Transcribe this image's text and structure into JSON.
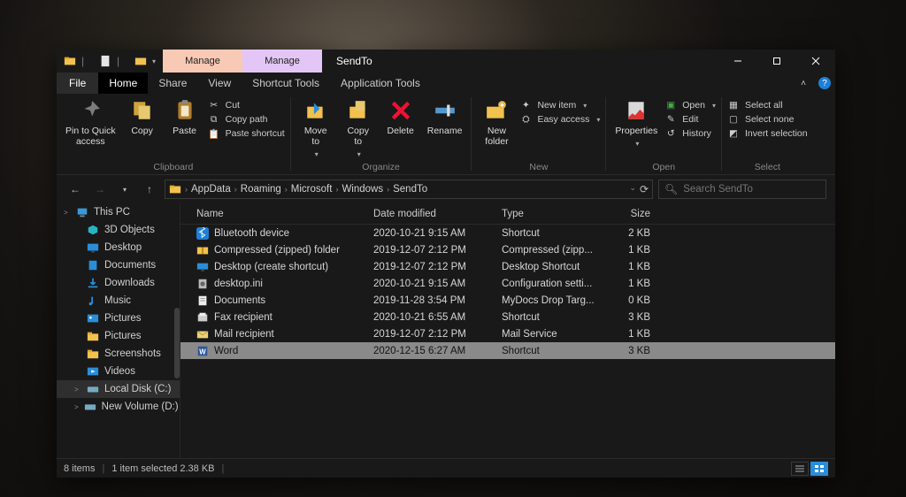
{
  "window": {
    "title": "SendTo",
    "context_tabs": [
      "Manage",
      "Manage"
    ],
    "sysbuttons": {
      "min": "minimize",
      "max": "maximize",
      "close": "close"
    }
  },
  "tabs": {
    "file": "File",
    "items": [
      "Home",
      "Share",
      "View",
      "Shortcut Tools",
      "Application Tools"
    ],
    "active": "Home"
  },
  "ribbon": {
    "clipboard": {
      "label": "Clipboard",
      "pin": "Pin to Quick\naccess",
      "copy": "Copy",
      "paste": "Paste",
      "cut": "Cut",
      "copy_path": "Copy path",
      "paste_shortcut": "Paste shortcut"
    },
    "organize": {
      "label": "Organize",
      "move_to": "Move\nto",
      "copy_to": "Copy\nto",
      "delete": "Delete",
      "rename": "Rename"
    },
    "new": {
      "label": "New",
      "new_folder": "New\nfolder",
      "new_item": "New item",
      "easy_access": "Easy access"
    },
    "open": {
      "label": "Open",
      "properties": "Properties",
      "open": "Open",
      "edit": "Edit",
      "history": "History"
    },
    "select": {
      "label": "Select",
      "select_all": "Select all",
      "select_none": "Select none",
      "invert": "Invert selection"
    }
  },
  "breadcrumb": [
    "AppData",
    "Roaming",
    "Microsoft",
    "Windows",
    "SendTo"
  ],
  "search": {
    "placeholder": "Search SendTo"
  },
  "nav": {
    "items": [
      {
        "label": "This PC",
        "icon": "pc",
        "indent": 0,
        "expand": ">"
      },
      {
        "label": "3D Objects",
        "icon": "3d",
        "indent": 1
      },
      {
        "label": "Desktop",
        "icon": "desktop",
        "indent": 1
      },
      {
        "label": "Documents",
        "icon": "documents",
        "indent": 1
      },
      {
        "label": "Downloads",
        "icon": "downloads",
        "indent": 1
      },
      {
        "label": "Music",
        "icon": "music",
        "indent": 1
      },
      {
        "label": "Pictures",
        "icon": "pictures-lib",
        "indent": 1
      },
      {
        "label": "Pictures",
        "icon": "folder",
        "indent": 1
      },
      {
        "label": "Screenshots",
        "icon": "folder",
        "indent": 1
      },
      {
        "label": "Videos",
        "icon": "videos",
        "indent": 1
      },
      {
        "label": "Local Disk (C:)",
        "icon": "disk",
        "indent": 1,
        "selected": true,
        "expand": ">"
      },
      {
        "label": "New Volume (D:)",
        "icon": "disk",
        "indent": 1,
        "expand": ">"
      }
    ]
  },
  "columns": {
    "name": "Name",
    "date": "Date modified",
    "type": "Type",
    "size": "Size"
  },
  "files": [
    {
      "name": "Bluetooth device",
      "icon": "bt",
      "date": "2020-10-21 9:15 AM",
      "type": "Shortcut",
      "size": "2 KB"
    },
    {
      "name": "Compressed (zipped) folder",
      "icon": "zip",
      "date": "2019-12-07 2:12 PM",
      "type": "Compressed (zipp...",
      "size": "1 KB"
    },
    {
      "name": "Desktop (create shortcut)",
      "icon": "desktop",
      "date": "2019-12-07 2:12 PM",
      "type": "Desktop Shortcut",
      "size": "1 KB"
    },
    {
      "name": "desktop.ini",
      "icon": "ini",
      "date": "2020-10-21 9:15 AM",
      "type": "Configuration setti...",
      "size": "1 KB"
    },
    {
      "name": "Documents",
      "icon": "documents",
      "date": "2019-11-28 3:54 PM",
      "type": "MyDocs Drop Targ...",
      "size": "0 KB"
    },
    {
      "name": "Fax recipient",
      "icon": "fax",
      "date": "2020-10-21 6:55 AM",
      "type": "Shortcut",
      "size": "3 KB"
    },
    {
      "name": "Mail recipient",
      "icon": "mail",
      "date": "2019-12-07 2:12 PM",
      "type": "Mail Service",
      "size": "1 KB"
    },
    {
      "name": "Word",
      "icon": "word",
      "date": "2020-12-15 6:27 AM",
      "type": "Shortcut",
      "size": "3 KB",
      "selected": true
    }
  ],
  "status": {
    "count": "8 items",
    "selection": "1 item selected  2.38 KB"
  }
}
